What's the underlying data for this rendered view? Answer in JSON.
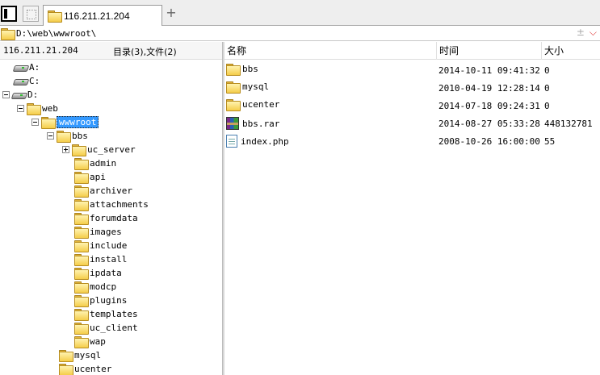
{
  "tabs": [
    {
      "label": "116.211.21.204"
    }
  ],
  "address": {
    "path": "D:\\web\\wwwroot\\",
    "plus_glyph": "±",
    "chevron_glyph": "⌵"
  },
  "left_panel": {
    "host": "116.211.21.204",
    "counts": "目录(3),文件(2)",
    "tree": [
      {
        "label": "A:"
      },
      {
        "label": "C:"
      },
      {
        "label": "D:"
      },
      {
        "label": "web"
      },
      {
        "label": "wwwroot"
      },
      {
        "label": "bbs"
      },
      {
        "label": "uc_server"
      },
      {
        "label": "admin"
      },
      {
        "label": "api"
      },
      {
        "label": "archiver"
      },
      {
        "label": "attachments"
      },
      {
        "label": "forumdata"
      },
      {
        "label": "images"
      },
      {
        "label": "include"
      },
      {
        "label": "install"
      },
      {
        "label": "ipdata"
      },
      {
        "label": "modcp"
      },
      {
        "label": "plugins"
      },
      {
        "label": "templates"
      },
      {
        "label": "uc_client"
      },
      {
        "label": "wap"
      },
      {
        "label": "mysql"
      },
      {
        "label": "ucenter"
      }
    ]
  },
  "file_list": {
    "columns": {
      "name": "名称",
      "time": "时间",
      "size": "大小"
    },
    "rows": [
      {
        "name": "bbs",
        "time": "2014-10-11 09:41:32",
        "size": "0",
        "icon": "folder-icon"
      },
      {
        "name": "mysql",
        "time": "2010-04-19 12:28:14",
        "size": "0",
        "icon": "folder-icon"
      },
      {
        "name": "ucenter",
        "time": "2014-07-18 09:24:31",
        "size": "0",
        "icon": "folder-icon"
      },
      {
        "name": "bbs.rar",
        "time": "2014-08-27 05:33:28",
        "size": "448132781",
        "icon": "rar-archive-icon"
      },
      {
        "name": "index.php",
        "time": "2008-10-26 16:00:00",
        "size": "55",
        "icon": "php-file-icon"
      }
    ]
  },
  "colors": {
    "selection": "#3399ff",
    "folder": "#f5cd4a",
    "chevron": "#dd3333"
  }
}
